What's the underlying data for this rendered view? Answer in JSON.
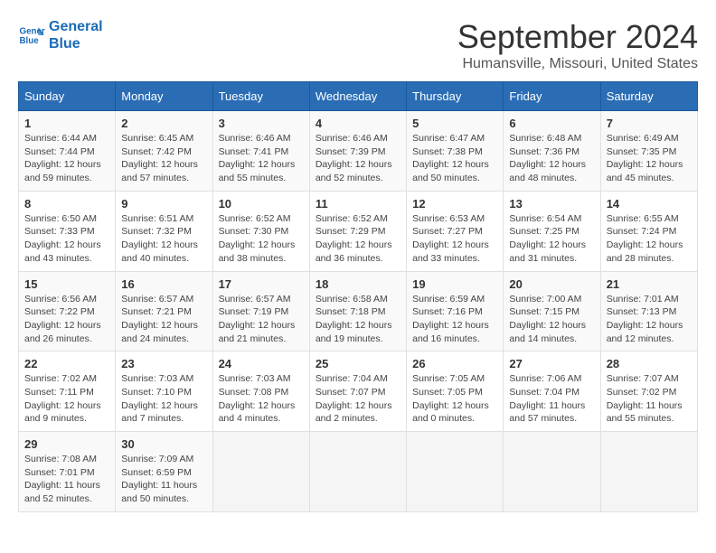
{
  "logo": {
    "line1": "General",
    "line2": "Blue"
  },
  "title": "September 2024",
  "location": "Humansville, Missouri, United States",
  "headers": [
    "Sunday",
    "Monday",
    "Tuesday",
    "Wednesday",
    "Thursday",
    "Friday",
    "Saturday"
  ],
  "weeks": [
    [
      {
        "day": "1",
        "info": "Sunrise: 6:44 AM\nSunset: 7:44 PM\nDaylight: 12 hours\nand 59 minutes."
      },
      {
        "day": "2",
        "info": "Sunrise: 6:45 AM\nSunset: 7:42 PM\nDaylight: 12 hours\nand 57 minutes."
      },
      {
        "day": "3",
        "info": "Sunrise: 6:46 AM\nSunset: 7:41 PM\nDaylight: 12 hours\nand 55 minutes."
      },
      {
        "day": "4",
        "info": "Sunrise: 6:46 AM\nSunset: 7:39 PM\nDaylight: 12 hours\nand 52 minutes."
      },
      {
        "day": "5",
        "info": "Sunrise: 6:47 AM\nSunset: 7:38 PM\nDaylight: 12 hours\nand 50 minutes."
      },
      {
        "day": "6",
        "info": "Sunrise: 6:48 AM\nSunset: 7:36 PM\nDaylight: 12 hours\nand 48 minutes."
      },
      {
        "day": "7",
        "info": "Sunrise: 6:49 AM\nSunset: 7:35 PM\nDaylight: 12 hours\nand 45 minutes."
      }
    ],
    [
      {
        "day": "8",
        "info": "Sunrise: 6:50 AM\nSunset: 7:33 PM\nDaylight: 12 hours\nand 43 minutes."
      },
      {
        "day": "9",
        "info": "Sunrise: 6:51 AM\nSunset: 7:32 PM\nDaylight: 12 hours\nand 40 minutes."
      },
      {
        "day": "10",
        "info": "Sunrise: 6:52 AM\nSunset: 7:30 PM\nDaylight: 12 hours\nand 38 minutes."
      },
      {
        "day": "11",
        "info": "Sunrise: 6:52 AM\nSunset: 7:29 PM\nDaylight: 12 hours\nand 36 minutes."
      },
      {
        "day": "12",
        "info": "Sunrise: 6:53 AM\nSunset: 7:27 PM\nDaylight: 12 hours\nand 33 minutes."
      },
      {
        "day": "13",
        "info": "Sunrise: 6:54 AM\nSunset: 7:25 PM\nDaylight: 12 hours\nand 31 minutes."
      },
      {
        "day": "14",
        "info": "Sunrise: 6:55 AM\nSunset: 7:24 PM\nDaylight: 12 hours\nand 28 minutes."
      }
    ],
    [
      {
        "day": "15",
        "info": "Sunrise: 6:56 AM\nSunset: 7:22 PM\nDaylight: 12 hours\nand 26 minutes."
      },
      {
        "day": "16",
        "info": "Sunrise: 6:57 AM\nSunset: 7:21 PM\nDaylight: 12 hours\nand 24 minutes."
      },
      {
        "day": "17",
        "info": "Sunrise: 6:57 AM\nSunset: 7:19 PM\nDaylight: 12 hours\nand 21 minutes."
      },
      {
        "day": "18",
        "info": "Sunrise: 6:58 AM\nSunset: 7:18 PM\nDaylight: 12 hours\nand 19 minutes."
      },
      {
        "day": "19",
        "info": "Sunrise: 6:59 AM\nSunset: 7:16 PM\nDaylight: 12 hours\nand 16 minutes."
      },
      {
        "day": "20",
        "info": "Sunrise: 7:00 AM\nSunset: 7:15 PM\nDaylight: 12 hours\nand 14 minutes."
      },
      {
        "day": "21",
        "info": "Sunrise: 7:01 AM\nSunset: 7:13 PM\nDaylight: 12 hours\nand 12 minutes."
      }
    ],
    [
      {
        "day": "22",
        "info": "Sunrise: 7:02 AM\nSunset: 7:11 PM\nDaylight: 12 hours\nand 9 minutes."
      },
      {
        "day": "23",
        "info": "Sunrise: 7:03 AM\nSunset: 7:10 PM\nDaylight: 12 hours\nand 7 minutes."
      },
      {
        "day": "24",
        "info": "Sunrise: 7:03 AM\nSunset: 7:08 PM\nDaylight: 12 hours\nand 4 minutes."
      },
      {
        "day": "25",
        "info": "Sunrise: 7:04 AM\nSunset: 7:07 PM\nDaylight: 12 hours\nand 2 minutes."
      },
      {
        "day": "26",
        "info": "Sunrise: 7:05 AM\nSunset: 7:05 PM\nDaylight: 12 hours\nand 0 minutes."
      },
      {
        "day": "27",
        "info": "Sunrise: 7:06 AM\nSunset: 7:04 PM\nDaylight: 11 hours\nand 57 minutes."
      },
      {
        "day": "28",
        "info": "Sunrise: 7:07 AM\nSunset: 7:02 PM\nDaylight: 11 hours\nand 55 minutes."
      }
    ],
    [
      {
        "day": "29",
        "info": "Sunrise: 7:08 AM\nSunset: 7:01 PM\nDaylight: 11 hours\nand 52 minutes."
      },
      {
        "day": "30",
        "info": "Sunrise: 7:09 AM\nSunset: 6:59 PM\nDaylight: 11 hours\nand 50 minutes."
      },
      {
        "day": "",
        "info": ""
      },
      {
        "day": "",
        "info": ""
      },
      {
        "day": "",
        "info": ""
      },
      {
        "day": "",
        "info": ""
      },
      {
        "day": "",
        "info": ""
      }
    ]
  ]
}
